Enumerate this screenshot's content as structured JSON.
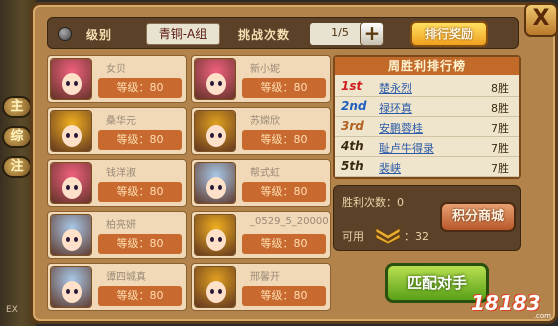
{
  "side_tabs": [
    "主",
    "综",
    "注"
  ],
  "side_bottom": "EX",
  "top": {
    "grade_label": "级别",
    "grade_value": "青铜-A组",
    "challenge_label": "挑战次数",
    "challenge_value": "1/5",
    "plus": "+",
    "rank_reward": "排行奖励",
    "close": "X"
  },
  "players": [
    {
      "name": "女贝",
      "level": "等级：80",
      "hair": "#f06080"
    },
    {
      "name": "新小妮",
      "level": "等级：80",
      "hair": "#f06080"
    },
    {
      "name": "桑华元",
      "level": "等级：80",
      "hair": "#f0b020"
    },
    {
      "name": "苏嫦欣",
      "level": "等级：80",
      "hair": "#e0a020"
    },
    {
      "name": "钱洋淑",
      "level": "等级：80",
      "hair": "#f06080"
    },
    {
      "name": "帮式虹",
      "level": "等级：80",
      "hair": "#a8c8e8"
    },
    {
      "name": "柏亮妍",
      "level": "等级：80",
      "hair": "#a8c8e8"
    },
    {
      "name": "_0529_5_20000",
      "level": "等级：80",
      "hair": "#f0b020"
    },
    {
      "name": "谭四城真",
      "level": "等级：80",
      "hair": "#a8c8e8"
    },
    {
      "name": "邢馨开",
      "level": "等级：80",
      "hair": "#e0a020"
    }
  ],
  "ranking": {
    "title": "周胜利排行榜",
    "rows": [
      {
        "rank": "1st",
        "name": "楚永烈",
        "wins": "8胜",
        "color": "#d02020"
      },
      {
        "rank": "2nd",
        "name": "禄环真",
        "wins": "8胜",
        "color": "#2060c0"
      },
      {
        "rank": "3rd",
        "name": "安鹏蓉桂",
        "wins": "7胜",
        "color": "#b06020"
      },
      {
        "rank": "4th",
        "name": "耻卢牛得录",
        "wins": "7胜",
        "color": "#3a2a10"
      },
      {
        "rank": "5th",
        "name": "裴峡",
        "wins": "7胜",
        "color": "#3a2a10"
      }
    ]
  },
  "stats": {
    "wins_label": "胜利次数：0",
    "available_label": "可用",
    "available_value": "：32",
    "shop_button": "积分商城"
  },
  "match_button": "匹配对手",
  "logo": {
    "text": "18183",
    "url": ".com"
  }
}
